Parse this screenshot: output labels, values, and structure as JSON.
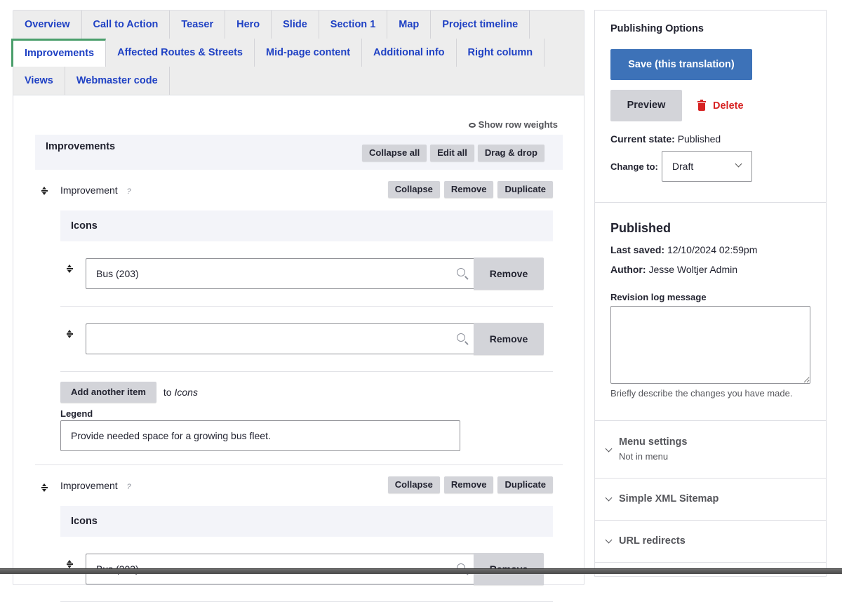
{
  "tabs": {
    "row1": [
      "Overview",
      "Call to Action",
      "Teaser",
      "Hero",
      "Slide",
      "Section 1",
      "Map",
      "Project timeline"
    ],
    "row2": [
      "Improvements",
      "Affected Routes & Streets",
      "Mid-page content",
      "Additional info",
      "Right column"
    ],
    "row3": [
      "Views",
      "Webmaster code"
    ],
    "active": "Improvements"
  },
  "show_row_weights": "Show row weights",
  "improvements": {
    "title": "Improvements",
    "collapse_all": "Collapse all",
    "edit_all": "Edit all",
    "drag_drop": "Drag & drop",
    "items": [
      {
        "label": "Improvement",
        "help": "?",
        "collapse": "Collapse",
        "remove": "Remove",
        "duplicate": "Duplicate",
        "icons_title": "Icons",
        "icons": [
          {
            "value": "Bus (203)",
            "remove": "Remove"
          },
          {
            "value": "",
            "remove": "Remove"
          }
        ],
        "add_another": "Add another item",
        "add_to": "to",
        "add_target": "Icons",
        "legend_label": "Legend",
        "legend_value": "Provide needed space for a growing bus fleet."
      },
      {
        "label": "Improvement",
        "help": "?",
        "collapse": "Collapse",
        "remove": "Remove",
        "duplicate": "Duplicate",
        "icons_title": "Icons",
        "icons": [
          {
            "value": "Bus (203)",
            "remove": "Remove"
          }
        ]
      }
    ]
  },
  "publishing": {
    "title": "Publishing Options",
    "save": "Save (this translation)",
    "preview": "Preview",
    "delete": "Delete",
    "current_state_label": "Current state:",
    "current_state": "Published",
    "change_to_label": "Change to:",
    "change_to_value": "Draft"
  },
  "meta": {
    "status": "Published",
    "last_saved_label": "Last saved:",
    "last_saved": "12/10/2024 02:59pm",
    "author_label": "Author:",
    "author": "Jesse Woltjer Admin",
    "revision_label": "Revision log message",
    "revision_value": "",
    "revision_desc": "Briefly describe the changes you have made."
  },
  "accordion": {
    "menu_settings": "Menu settings",
    "menu_settings_summary": "Not in menu",
    "xml_sitemap": "Simple XML Sitemap",
    "url_redirects": "URL redirects"
  },
  "colors": {
    "tab_link": "#1f41c4",
    "active_tab_border": "#4a9e6b",
    "primary_button": "#3d72b8",
    "delete": "#d72222"
  }
}
